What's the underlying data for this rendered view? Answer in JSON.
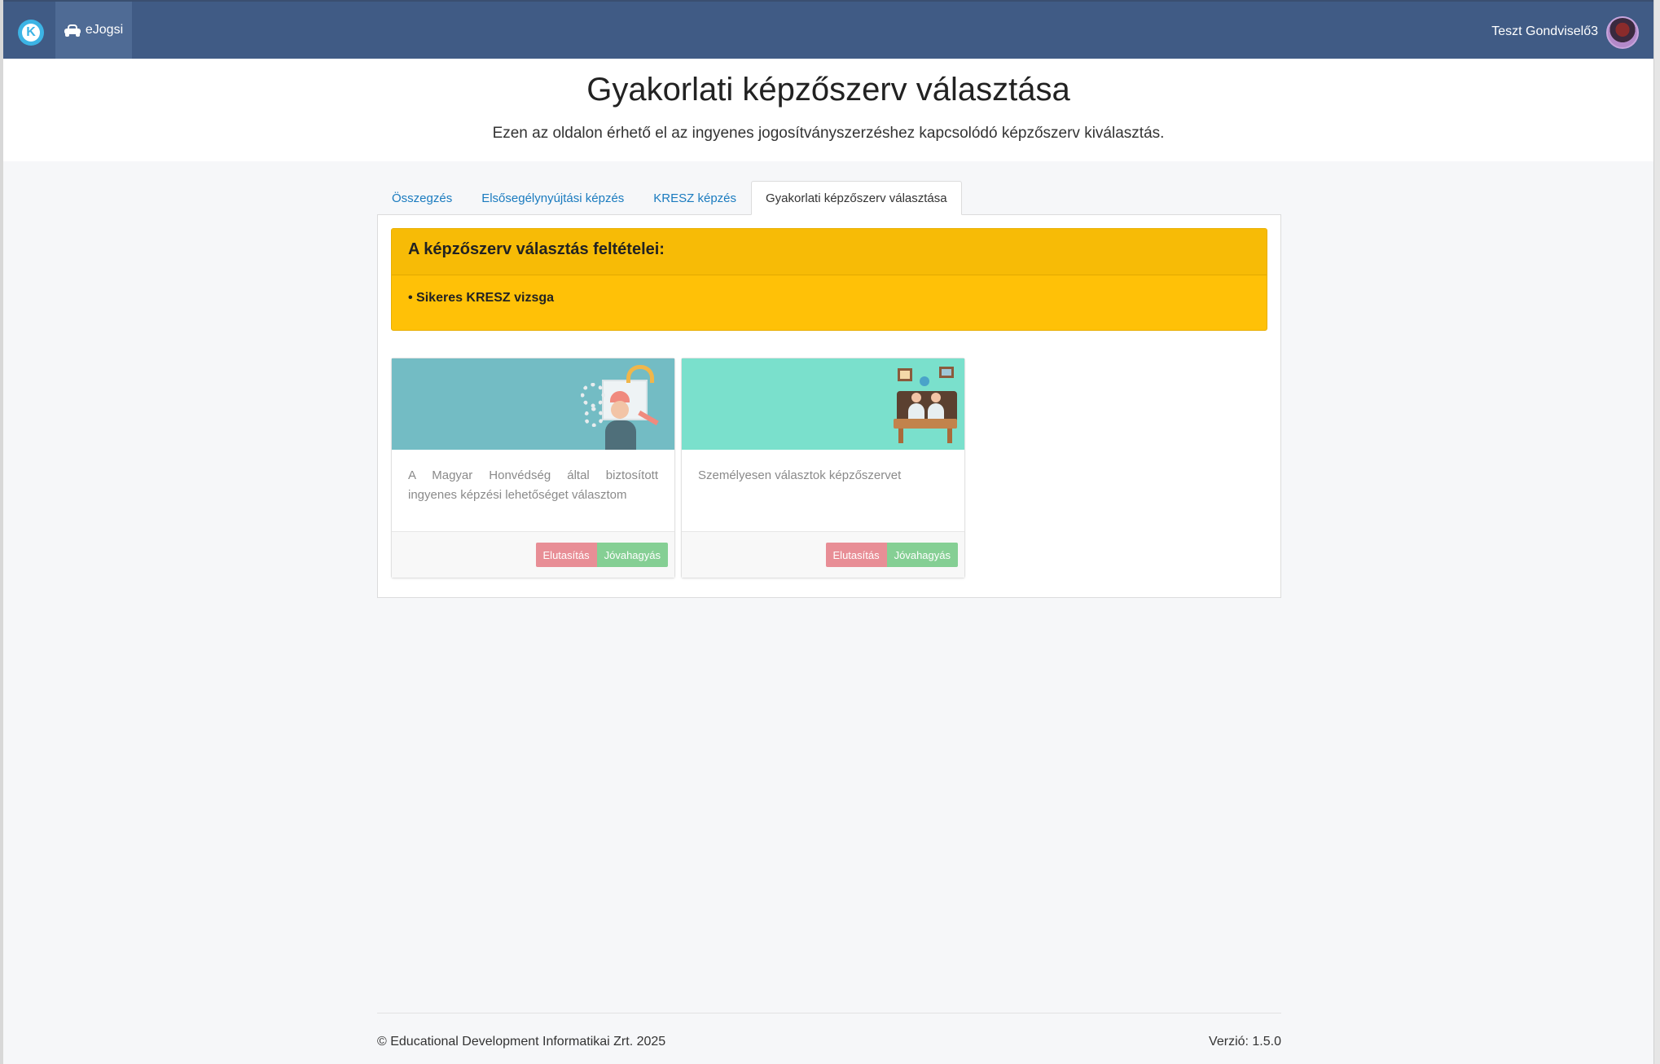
{
  "navbar": {
    "logo_letter": "K",
    "app_label": "eJogsi",
    "user_name": "Teszt Gondviselő3"
  },
  "header": {
    "title": "Gyakorlati képzőszerv választása",
    "subtitle": "Ezen az oldalon érhető el az ingyenes jogosítványszerzéshez kapcsolódó képzőszerv kiválasztás."
  },
  "tabs": [
    {
      "label": "Összegzés",
      "active": false
    },
    {
      "label": "Elsősegélynyújtási képzés",
      "active": false
    },
    {
      "label": "KRESZ képzés",
      "active": false
    },
    {
      "label": "Gyakorlati képzőszerv választása",
      "active": true
    }
  ],
  "alert": {
    "title": "A képzőszerv választás feltételei:",
    "item": "• Sikeres KRESZ vizsga"
  },
  "cards": [
    {
      "text": "A Magyar Honvédség által biztosított ingyenes képzési lehetőséget választom",
      "reject_label": "Elutasítás",
      "approve_label": "Jóvahagyás"
    },
    {
      "text": "Személyesen választok képzőszervet",
      "reject_label": "Elutasítás",
      "approve_label": "Jóvahagyás"
    }
  ],
  "footer": {
    "copyright": "© Educational Development Informatikai Zrt. 2025",
    "version": "Verzió: 1.5.0"
  },
  "colors": {
    "navbar": "#405b85",
    "alert": "#ffc107",
    "reject": "#e88e96",
    "approve": "#85cf94",
    "link": "#1a7bbf"
  }
}
